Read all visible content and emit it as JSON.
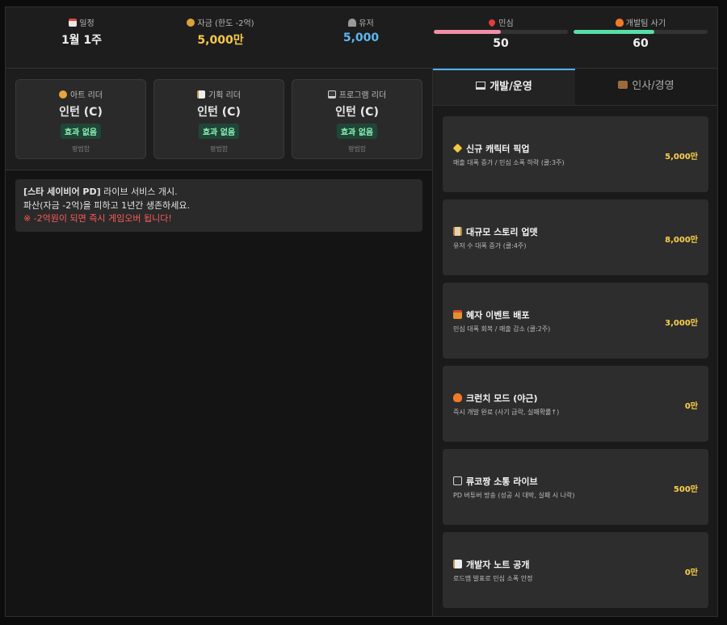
{
  "stats": {
    "schedule": {
      "label": "일정",
      "value": "1월 1주",
      "icon": "calendar-icon"
    },
    "funds": {
      "label": "자금 (한도 -2억)",
      "value": "5,000만",
      "icon": "money-bag-icon",
      "color": "#f7c94a"
    },
    "users": {
      "label": "유저",
      "value": "5,000",
      "icon": "user-icon",
      "color": "#5db8f2"
    },
    "sentiment": {
      "label": "민심",
      "value": "50",
      "level": 0.5,
      "icon": "heart-icon",
      "bar_color": "#f18fa7"
    },
    "morale": {
      "label": "개발팀 사기",
      "value": "60",
      "level": 0.6,
      "icon": "fire-icon",
      "bar_color": "#56e0a3"
    }
  },
  "leaders": [
    {
      "name": "아트 리더",
      "rank": "인턴 (C)",
      "effect": "효과 없음",
      "tag": "평범함",
      "icon": "palette-icon"
    },
    {
      "name": "기획 리더",
      "rank": "인턴 (C)",
      "effect": "효과 없음",
      "tag": "평범함",
      "icon": "memo-icon"
    },
    {
      "name": "프로그램 리더",
      "rank": "인턴 (C)",
      "effect": "효과 없음",
      "tag": "평범함",
      "icon": "laptop-icon"
    }
  ],
  "log": {
    "title": "[스타 세이비어 PD]",
    "line1": "라이브 서비스 개시.",
    "line2": "파산(자금 -2억)을 피하고 1년간 생존하세요.",
    "warning": "※ -2억원이 되면 즉시 게임오버 됩니다!"
  },
  "tabs": [
    {
      "label": "개발/운영",
      "icon": "monitor-icon",
      "active": true
    },
    {
      "label": "인사/경영",
      "icon": "briefcase-icon",
      "active": false
    }
  ],
  "actions": [
    {
      "title": "신규 캐릭터 픽업",
      "desc": "매출 대폭 증가 / 민심 소폭 하락 (쿨:3주)",
      "cost": "5,000만",
      "icon": "sparkles-icon"
    },
    {
      "title": "대규모 스토리 업뎃",
      "desc": "유저 수 대폭 증가 (쿨:4주)",
      "cost": "8,000만",
      "icon": "scroll-icon"
    },
    {
      "title": "혜자 이벤트 배포",
      "desc": "민심 대폭 회복 / 매출 감소 (쿨:2주)",
      "cost": "3,000만",
      "icon": "gift-icon"
    },
    {
      "title": "크런치 모드 (야근)",
      "desc": "즉시 개발 완료 (사기 급락, 실패확률↑)",
      "cost": "0만",
      "icon": "fire-icon"
    },
    {
      "title": "류코짱 소통 라이브",
      "desc": "PD 버튜버 방송 (성공 시 대박, 실패 시 나락)",
      "cost": "500만",
      "icon": "tv-icon"
    },
    {
      "title": "개발자 노트 공개",
      "desc": "로드맵 발표로 민심 소폭 안정",
      "cost": "0만",
      "icon": "memo-icon"
    }
  ]
}
